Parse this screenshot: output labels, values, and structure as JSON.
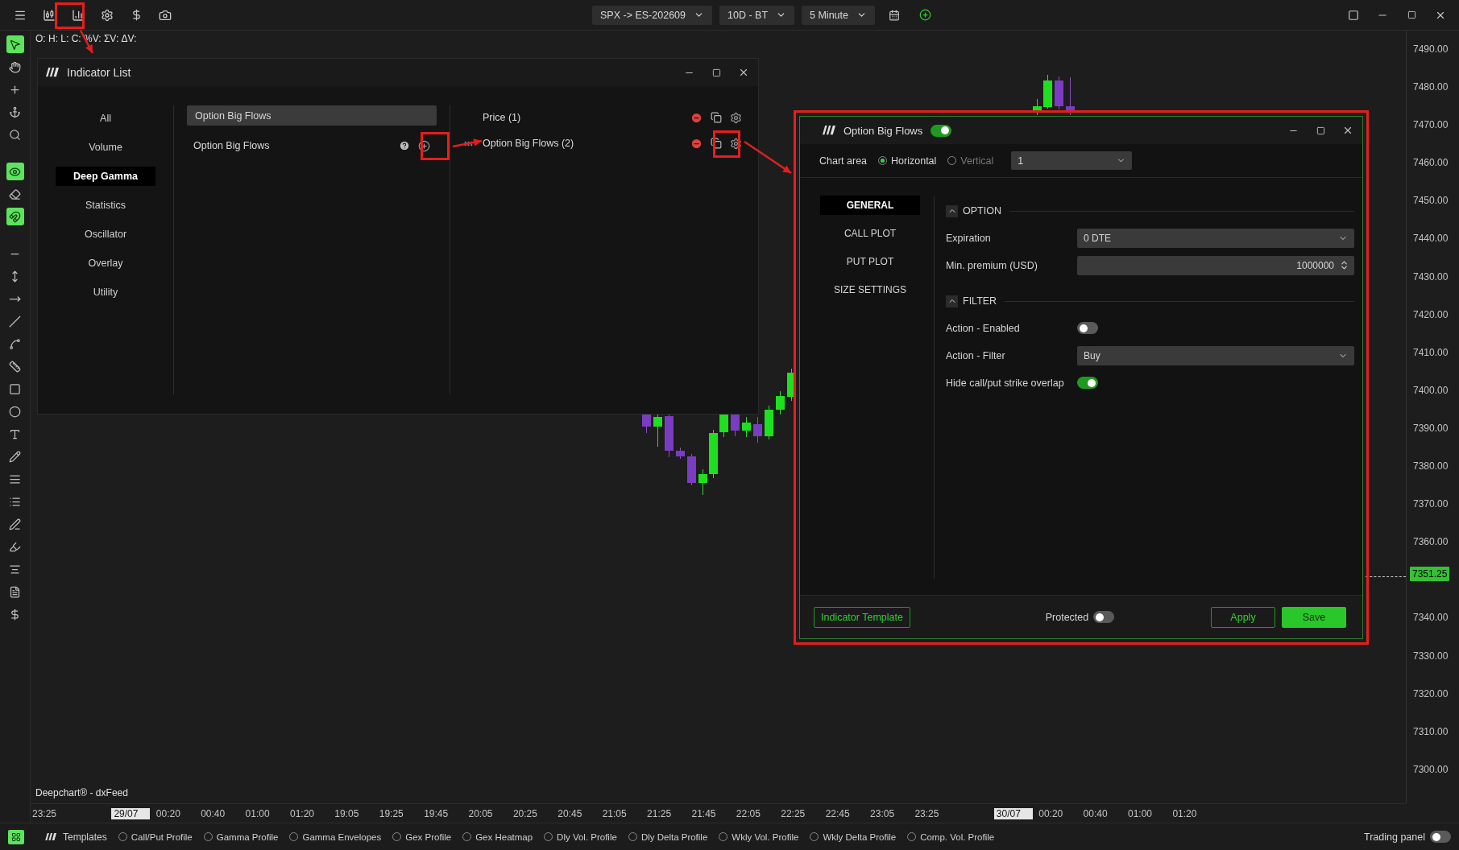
{
  "top_bar": {
    "selectors": [
      {
        "label": "SPX -> ES-202609"
      },
      {
        "label": "10D - BT"
      },
      {
        "label": "5 Minute"
      }
    ]
  },
  "tools": [
    [
      {
        "on": true
      },
      {
        "on": false
      },
      {
        "on": false
      },
      {
        "on": false
      },
      {
        "on": false
      }
    ],
    [
      {
        "on": true
      },
      {
        "on": false
      },
      {
        "on": true
      }
    ],
    [
      {
        "on": false
      },
      {
        "on": false
      },
      {
        "on": false
      },
      {
        "on": false
      },
      {
        "on": false
      },
      {
        "on": false
      },
      {
        "on": false
      },
      {
        "on": false
      },
      {
        "on": false
      },
      {
        "on": false
      },
      {
        "on": false
      },
      {
        "on": false
      },
      {
        "on": false
      },
      {
        "on": false
      },
      {
        "on": false
      },
      {
        "on": false
      },
      {
        "on": false
      }
    ]
  ],
  "ohlc_label": "O: H: L: C: %V: ΣV: ΔV:",
  "source_label": "Deepchart® - dxFeed",
  "price_axis": [
    {
      "label": "7490.00",
      "kind": "tick"
    },
    {
      "label": "7480.00",
      "kind": "tick"
    },
    {
      "label": "7470.00",
      "kind": "tick"
    },
    {
      "label": "7460.00",
      "kind": "tick"
    },
    {
      "label": "7450.00",
      "kind": "tick"
    },
    {
      "label": "7440.00",
      "kind": "tick"
    },
    {
      "label": "7430.00",
      "kind": "tick"
    },
    {
      "label": "7420.00",
      "kind": "tick"
    },
    {
      "label": "7410.00",
      "kind": "tick"
    },
    {
      "label": "7400.00",
      "kind": "tick"
    },
    {
      "label": "7390.00",
      "kind": "tick"
    },
    {
      "label": "7380.00",
      "kind": "tick"
    },
    {
      "label": "7370.00",
      "kind": "tick"
    },
    {
      "label": "7360.00",
      "kind": "tick"
    },
    {
      "label": "7351.25",
      "kind": "current"
    },
    {
      "label": "7340.00",
      "kind": "tick"
    },
    {
      "label": "7330.00",
      "kind": "tick"
    },
    {
      "label": "7320.00",
      "kind": "tick"
    },
    {
      "label": "7310.00",
      "kind": "tick"
    },
    {
      "label": "7300.00",
      "kind": "tick"
    }
  ],
  "time_axis": [
    {
      "label": "23:25",
      "kind": "time"
    },
    {
      "label": "29/07",
      "kind": "date"
    },
    {
      "label": "00:20",
      "kind": "time"
    },
    {
      "label": "00:40",
      "kind": "time"
    },
    {
      "label": "01:00",
      "kind": "time"
    },
    {
      "label": "01:20",
      "kind": "time"
    },
    {
      "label": "19:05",
      "kind": "time"
    },
    {
      "label": "19:25",
      "kind": "time"
    },
    {
      "label": "19:45",
      "kind": "time"
    },
    {
      "label": "20:05",
      "kind": "time"
    },
    {
      "label": "20:25",
      "kind": "time"
    },
    {
      "label": "20:45",
      "kind": "time"
    },
    {
      "label": "21:05",
      "kind": "time"
    },
    {
      "label": "21:25",
      "kind": "time"
    },
    {
      "label": "21:45",
      "kind": "time"
    },
    {
      "label": "22:05",
      "kind": "time"
    },
    {
      "label": "22:25",
      "kind": "time"
    },
    {
      "label": "22:45",
      "kind": "time"
    },
    {
      "label": "23:05",
      "kind": "time"
    },
    {
      "label": "23:25",
      "kind": "time"
    },
    {
      "label": "30/07",
      "kind": "date"
    },
    {
      "label": "00:20",
      "kind": "time"
    },
    {
      "label": "00:40",
      "kind": "time"
    },
    {
      "label": "01:00",
      "kind": "time"
    },
    {
      "label": "01:20",
      "kind": "time"
    }
  ],
  "bottom_bar": {
    "templates_label": "Templates",
    "profiles": [
      {
        "label": "Call/Put Profile",
        "checked": false
      },
      {
        "label": "Gamma Profile",
        "checked": false
      },
      {
        "label": "Gamma Envelopes",
        "checked": false
      },
      {
        "label": "Gex Profile",
        "checked": false
      },
      {
        "label": "Gex Heatmap",
        "checked": false
      },
      {
        "label": "Dly Vol. Profile",
        "checked": false
      },
      {
        "label": "Dly Delta Profile",
        "checked": false
      },
      {
        "label": "Wkly Vol. Profile",
        "checked": false
      },
      {
        "label": "Wkly Delta Profile",
        "checked": false
      },
      {
        "label": "Comp. Vol. Profile",
        "checked": false
      }
    ],
    "trading_panel": {
      "label": "Trading panel",
      "on": false
    }
  },
  "indicator_list": {
    "title": "Indicator List",
    "categories": [
      {
        "label": "All",
        "selected": false
      },
      {
        "label": "Volume",
        "selected": false
      },
      {
        "label": "Deep Gamma",
        "selected": true
      },
      {
        "label": "Statistics",
        "selected": false
      },
      {
        "label": "Oscillator",
        "selected": false
      },
      {
        "label": "Overlay",
        "selected": false
      },
      {
        "label": "Utility",
        "selected": false
      }
    ],
    "search": {
      "value": "Option Big Flows"
    },
    "available": [
      {
        "name": "Option Big Flows"
      }
    ],
    "active": [
      {
        "name": "Price (1)",
        "hovered": false
      },
      {
        "name": "Option Big Flows (2)",
        "hovered": true
      }
    ]
  },
  "settings_dialog": {
    "title": "Option Big Flows",
    "enabled": true,
    "chart_area": {
      "label": "Chart area",
      "options": [
        {
          "label": "Horizontal",
          "selected": true
        },
        {
          "label": "Vertical",
          "selected": false
        }
      ],
      "pane": "1"
    },
    "nav": [
      {
        "label": "GENERAL",
        "selected": true
      },
      {
        "label": "CALL PLOT",
        "selected": false
      },
      {
        "label": "PUT PLOT",
        "selected": false
      },
      {
        "label": "SIZE SETTINGS",
        "selected": false
      }
    ],
    "sections": [
      {
        "title": "OPTION",
        "expanded": true,
        "fields": [
          {
            "label": "Expiration",
            "kind": "dropdown",
            "value": "0 DTE"
          },
          {
            "label": "Min. premium (USD)",
            "kind": "number",
            "value": "1000000"
          }
        ]
      },
      {
        "title": "FILTER",
        "expanded": true,
        "fields": [
          {
            "label": "Action - Enabled",
            "kind": "toggle",
            "on": false
          },
          {
            "label": "Action - Filter",
            "kind": "dropdown",
            "value": "Buy"
          },
          {
            "label": "Hide call/put strike overlap",
            "kind": "toggle",
            "on": true
          }
        ]
      }
    ],
    "footer": {
      "template_button": "Indicator Template",
      "protected": {
        "label": "Protected",
        "on": false
      },
      "apply": "Apply",
      "save": "Save"
    }
  }
}
